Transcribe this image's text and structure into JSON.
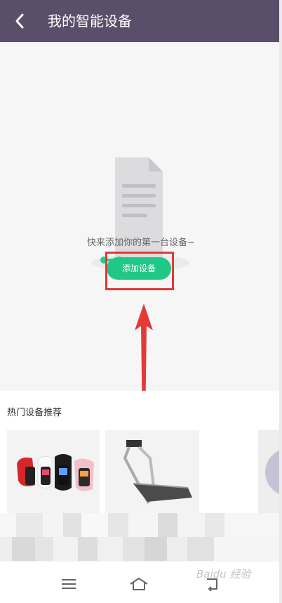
{
  "header": {
    "title": "我的智能设备",
    "back_icon": "chevron-left-icon",
    "background": "#5a4e6a"
  },
  "empty_state": {
    "illustration_icon": "document-icon",
    "message": "快来添加你的第一台设备~",
    "add_button_label": "添加设备",
    "accent_color": "#1fc884"
  },
  "recommend": {
    "title": "热门设备推荐",
    "products": [
      {
        "icon": "smart-band-icon"
      },
      {
        "icon": "treadmill-icon"
      },
      {
        "icon": "blank-product"
      },
      {
        "icon": "partial-product"
      }
    ]
  },
  "navbar": {
    "menu_icon": "menu-icon",
    "home_icon": "home-icon",
    "back_icon": "back-icon"
  },
  "watermark": {
    "text": "Baidu 经验"
  },
  "annotation": {
    "highlight_color": "#e53935"
  }
}
